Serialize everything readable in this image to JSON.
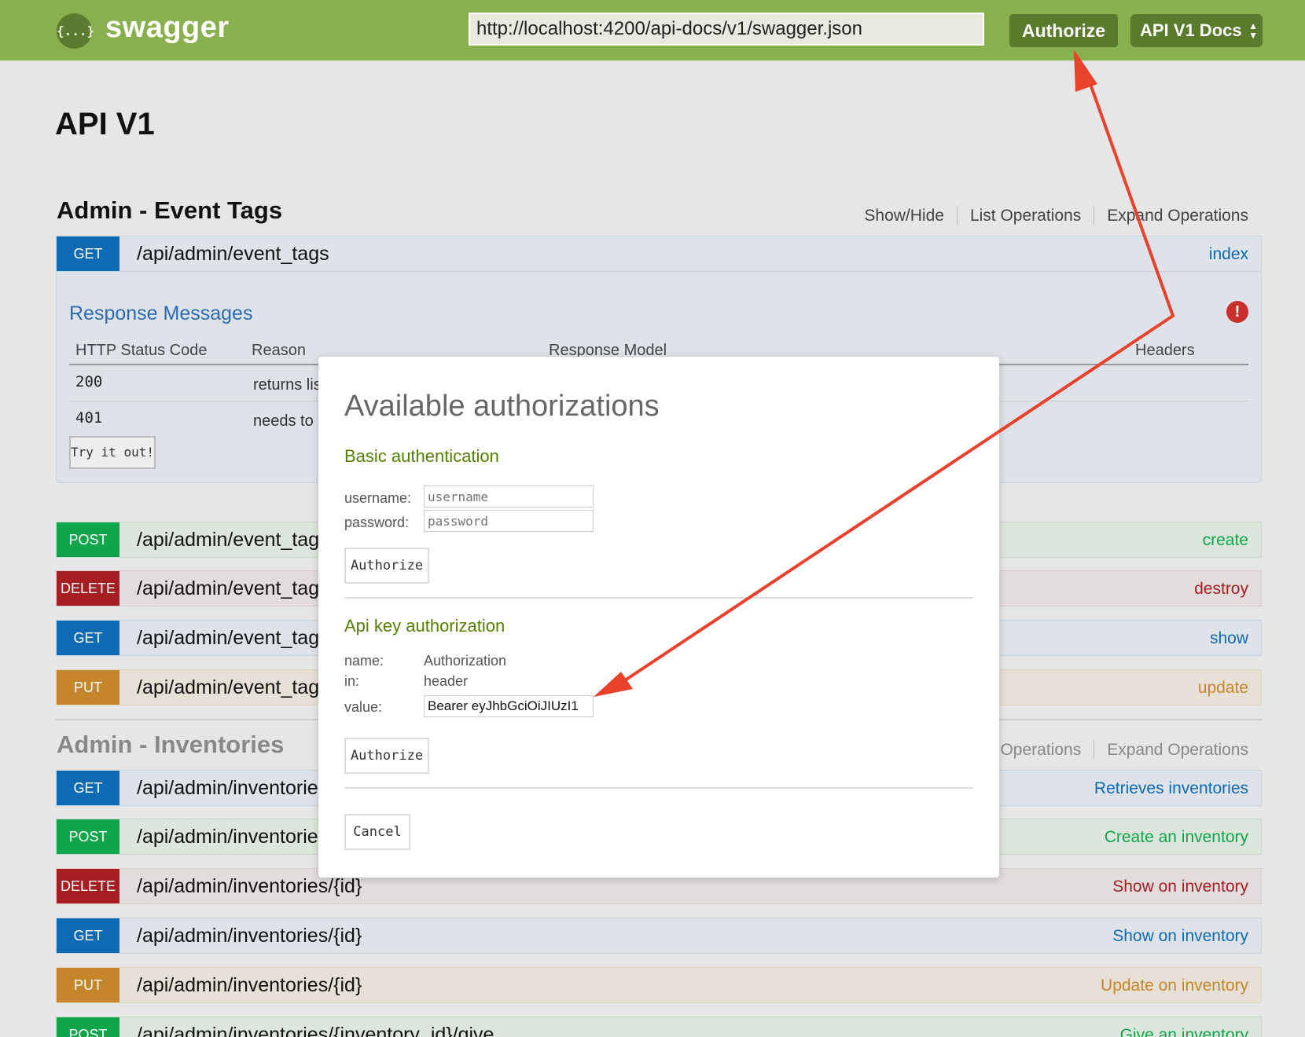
{
  "topbar": {
    "logo_glyph": "{...}",
    "logo_text": "swagger",
    "url_value": "http://localhost:4200/api-docs/v1/swagger.json",
    "authorize_label": "Authorize",
    "docs_label": "API V1 Docs",
    "color": "#89b04f"
  },
  "page_title": "API V1",
  "sections": {
    "event_tags": {
      "title": "Admin - Event Tags",
      "links": [
        "Show/Hide",
        "List Operations",
        "Expand Operations"
      ]
    },
    "inventories": {
      "title": "Admin - Inventories",
      "links": [
        "Operations",
        "Expand Operations"
      ]
    }
  },
  "expanded_op": {
    "method": "GET",
    "path": "/api/admin/event_tags",
    "summary": "index",
    "response_title": "Response Messages",
    "warning_icon": "exclamation-circle-icon",
    "table_headers": [
      "HTTP Status Code",
      "Reason",
      "Response Model",
      "Headers"
    ],
    "rows": [
      {
        "code": "200",
        "reason": "returns lis"
      },
      {
        "code": "401",
        "reason": "needs to"
      }
    ],
    "try_label": "Try it out!"
  },
  "event_tag_ops": [
    {
      "method": "POST",
      "path": "/api/admin/event_tag",
      "summary": "create"
    },
    {
      "method": "DELETE",
      "path": "/api/admin/event_tag",
      "summary": "destroy"
    },
    {
      "method": "GET",
      "path": "/api/admin/event_tag",
      "summary": "show"
    },
    {
      "method": "PUT",
      "path": "/api/admin/event_tag",
      "summary": "update"
    }
  ],
  "inventory_ops": [
    {
      "method": "GET",
      "path": "/api/admin/inventorie",
      "summary": "Retrieves inventories"
    },
    {
      "method": "POST",
      "path": "/api/admin/inventorie",
      "summary": "Create an inventory"
    },
    {
      "method": "DELETE",
      "path": "/api/admin/inventories/{id}",
      "summary": "Show on inventory"
    },
    {
      "method": "GET",
      "path": "/api/admin/inventories/{id}",
      "summary": "Show on inventory"
    },
    {
      "method": "PUT",
      "path": "/api/admin/inventories/{id}",
      "summary": "Update on inventory"
    },
    {
      "method": "POST",
      "path": "/api/admin/inventories/{inventory_id}/give",
      "summary": "Give an inventory"
    }
  ],
  "modal": {
    "title": "Available authorizations",
    "basic": {
      "heading": "Basic authentication",
      "username_label": "username:",
      "username_placeholder": "username",
      "password_label": "password:",
      "password_placeholder": "password",
      "button": "Authorize"
    },
    "apikey": {
      "heading": "Api key authorization",
      "name_label": "name:",
      "name_value": "Authorization",
      "in_label": "in:",
      "in_value": "header",
      "value_label": "value:",
      "value": "Bearer eyJhbGciOiJIUzI1",
      "button": "Authorize"
    },
    "cancel": "Cancel"
  },
  "annotation_color": "#e8412c"
}
